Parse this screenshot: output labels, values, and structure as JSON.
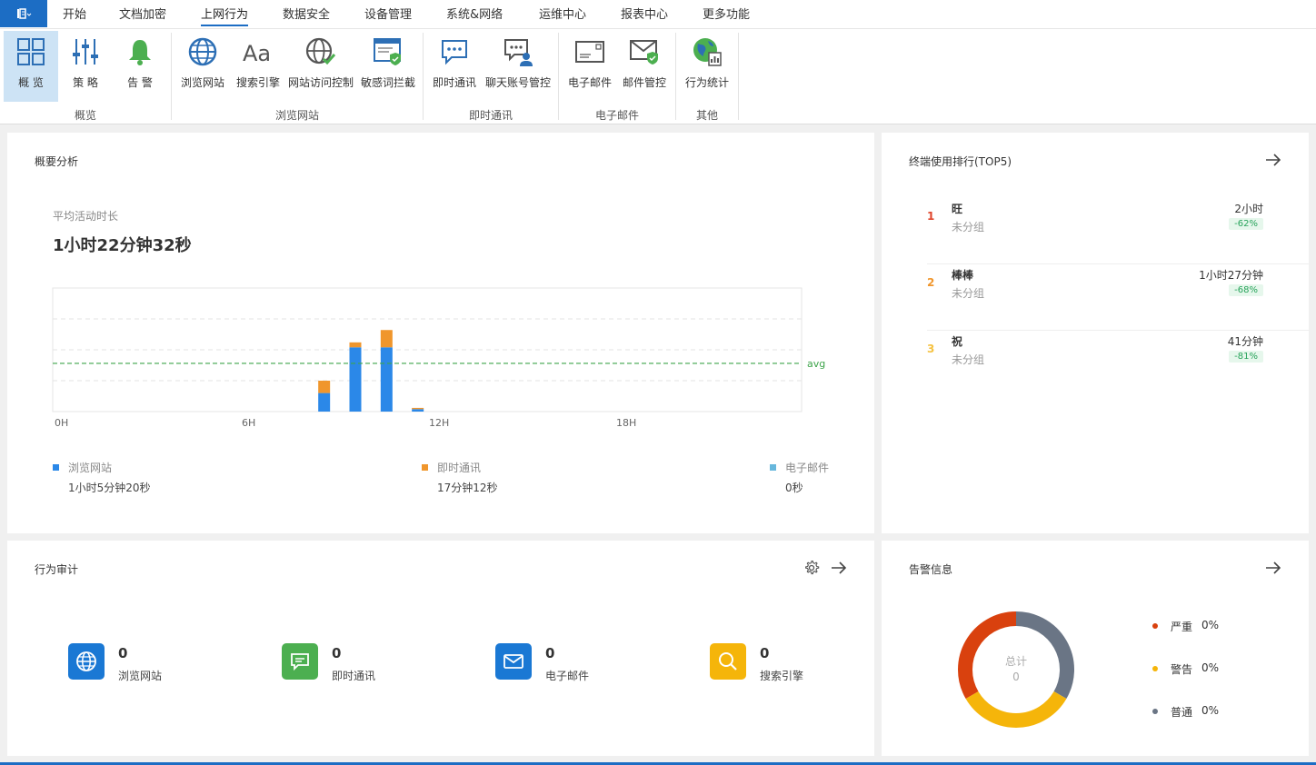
{
  "menu": {
    "tabs": [
      "开始",
      "文档加密",
      "上网行为",
      "数据安全",
      "设备管理",
      "系统&网络",
      "运维中心",
      "报表中心",
      "更多功能"
    ],
    "active_index": 2
  },
  "ribbon": {
    "groups": [
      {
        "label": "概览",
        "items": [
          {
            "label": "概 览",
            "icon": "overview-grid-icon",
            "selected": true
          },
          {
            "label": "策 略",
            "icon": "policy-sliders-icon"
          },
          {
            "label": "告 警",
            "icon": "alarm-bell-icon"
          }
        ]
      },
      {
        "label": "浏览网站",
        "items": [
          {
            "label": "浏览网站",
            "icon": "globe-icon"
          },
          {
            "label": "搜索引擎",
            "icon": "font-aa-icon"
          },
          {
            "label": "网站访问控制",
            "icon": "globe-check-icon"
          },
          {
            "label": "敏感词拦截",
            "icon": "window-shield-icon"
          }
        ]
      },
      {
        "label": "即时通讯",
        "items": [
          {
            "label": "即时通讯",
            "icon": "chat-bubble-icon"
          },
          {
            "label": "聊天账号管控",
            "icon": "chat-user-icon"
          }
        ]
      },
      {
        "label": "电子邮件",
        "items": [
          {
            "label": "电子邮件",
            "icon": "envelope-icon"
          },
          {
            "label": "邮件管控",
            "icon": "envelope-shield-icon"
          }
        ]
      },
      {
        "label": "其他",
        "items": [
          {
            "label": "行为统计",
            "icon": "globe-stats-icon"
          }
        ]
      }
    ]
  },
  "overview": {
    "title": "概要分析",
    "avg_label": "平均活动时长",
    "avg_value": "1小时22分钟32秒",
    "legend": [
      {
        "name": "浏览网站",
        "value": "1小时5分钟20秒",
        "color": "#2b88e8"
      },
      {
        "name": "即时通讯",
        "value": "17分钟12秒",
        "color": "#f0962c"
      },
      {
        "name": "电子邮件",
        "value": "0秒",
        "color": "#67b7dc"
      }
    ]
  },
  "chart_data": {
    "type": "bar",
    "stacked": true,
    "x_ticks": [
      "0H",
      "6H",
      "12H",
      "18H"
    ],
    "x_range": [
      0,
      24
    ],
    "avg_label": "avg",
    "avg_level": 0.39,
    "grid": true,
    "series": [
      {
        "name": "浏览网站",
        "color": "#2b88e8",
        "points": [
          [
            8,
            0.15
          ],
          [
            9,
            0.52
          ],
          [
            10,
            0.52
          ],
          [
            11,
            0.02
          ]
        ]
      },
      {
        "name": "即时通讯",
        "color": "#f0962c",
        "points": [
          [
            8,
            0.1
          ],
          [
            9,
            0.04
          ],
          [
            10,
            0.14
          ],
          [
            11,
            0.01
          ]
        ]
      },
      {
        "name": "电子邮件",
        "color": "#67b7dc",
        "points": []
      }
    ]
  },
  "ranking": {
    "title": "终端使用排行(TOP5)",
    "items": [
      {
        "rank": "1",
        "name": "旺",
        "group": "未分组",
        "time": "2小时",
        "pct": "-62%",
        "color": "#e0462d"
      },
      {
        "rank": "2",
        "name": "棒棒",
        "group": "未分组",
        "time": "1小时27分钟",
        "pct": "-68%",
        "color": "#f0962c"
      },
      {
        "rank": "3",
        "name": "祝",
        "group": "未分组",
        "time": "41分钟",
        "pct": "-81%",
        "color": "#f5c242"
      }
    ]
  },
  "audit": {
    "title": "行为审计",
    "items": [
      {
        "count": "0",
        "label": "浏览网站",
        "color": "#1a78d4",
        "icon": "globe-icon"
      },
      {
        "count": "0",
        "label": "即时通讯",
        "color": "#4caf50",
        "icon": "chat-bubble-icon"
      },
      {
        "count": "0",
        "label": "电子邮件",
        "color": "#1a78d4",
        "icon": "envelope-icon"
      },
      {
        "count": "0",
        "label": "搜索引擎",
        "color": "#f5b50a",
        "icon": "search-icon"
      }
    ]
  },
  "alarm": {
    "title": "告警信息",
    "total_label": "总计",
    "total_value": "0",
    "legend": [
      {
        "label": "严重",
        "pct": "0%",
        "color": "#d9410e"
      },
      {
        "label": "警告",
        "pct": "0%",
        "color": "#f5b50a"
      },
      {
        "label": "普通",
        "pct": "0%",
        "color": "#6a7585"
      }
    ],
    "ring": [
      {
        "color": "#6a7585",
        "fraction": 0.3333
      },
      {
        "color": "#f5b50a",
        "fraction": 0.3333
      },
      {
        "color": "#d9410e",
        "fraction": 0.3334
      }
    ]
  }
}
